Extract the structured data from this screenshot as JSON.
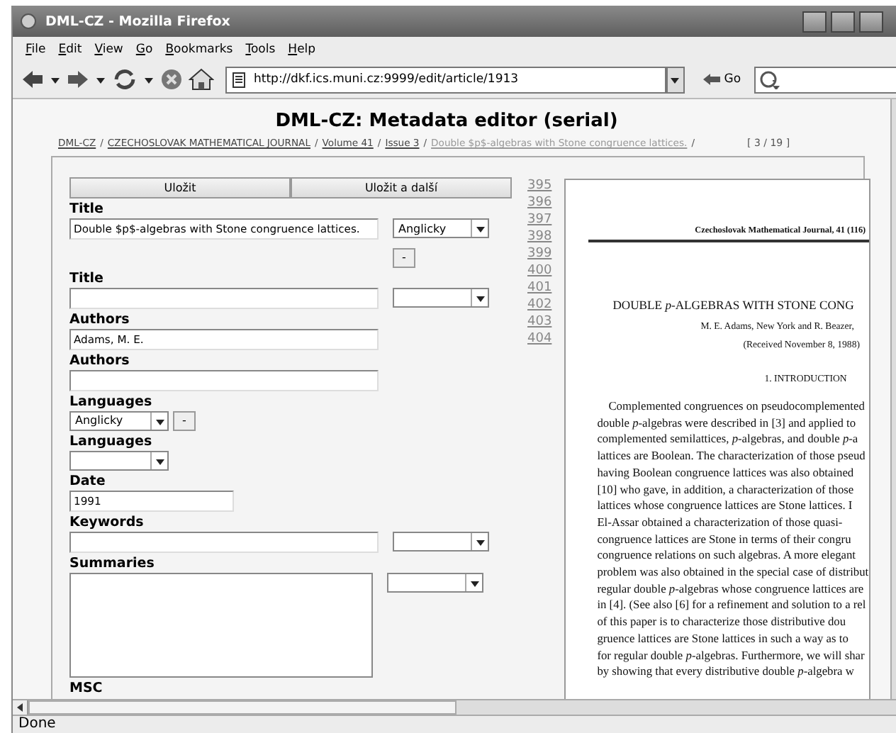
{
  "window": {
    "title": "DML-CZ - Mozilla Firefox"
  },
  "menu": [
    "File",
    "Edit",
    "View",
    "Go",
    "Bookmarks",
    "Tools",
    "Help"
  ],
  "toolbar": {
    "url": "http://dkf.ics.muni.cz:9999/edit/article/1913",
    "go": "Go"
  },
  "page": {
    "heading": "DML-CZ: Metadata editor (serial)",
    "breadcrumb": [
      {
        "label": "DML-CZ",
        "kind": "link",
        "after": "/"
      },
      {
        "label": "CZECHOSLOVAK MATHEMATICAL JOURNAL",
        "kind": "link",
        "after": "/"
      },
      {
        "label": "Volume 41",
        "kind": "link",
        "after": "/"
      },
      {
        "label": "Issue 3",
        "kind": "link",
        "after": "/"
      },
      {
        "label": "Double $p$-algebras with Stone congruence lattices.",
        "kind": "current",
        "after": "/"
      }
    ],
    "counter": "[ 3 / 19 ]",
    "buttons": [
      "Uložit",
      "Uložit a další"
    ],
    "fields": [
      {
        "label": "Title",
        "kind": "titled",
        "value": "Double $p$-algebras with Stone congruence lattices.",
        "language": "Anglicky",
        "remove": "-"
      },
      {
        "label": "Title",
        "kind": "titled"
      },
      {
        "label": "Authors",
        "kind": "plain",
        "value": "Adams, M. E."
      },
      {
        "label": "Authors",
        "kind": "plain"
      },
      {
        "label": "Languages",
        "kind": "select",
        "value": "Anglicky",
        "remove": "-"
      },
      {
        "label": "Languages",
        "kind": "select"
      },
      {
        "label": "Date",
        "kind": "short",
        "value": "1991"
      },
      {
        "label": "Keywords",
        "kind": "titled"
      },
      {
        "label": "Summaries",
        "kind": "area"
      },
      {
        "label": "MSC",
        "kind": "none"
      }
    ],
    "line_numbers": [
      "395",
      "396",
      "397",
      "398",
      "399",
      "400",
      "401",
      "402",
      "403",
      "404"
    ],
    "document": {
      "journal": "Czechoslovak Mathematical Journal, 41 (116)",
      "title": "DOUBLE *p*-ALGEBRAS WITH STONE CONG",
      "authors": "M. E. Adams, New York and R. Beazer,",
      "received": "(Received November 8, 1988)",
      "section": "1. INTRODUCTION",
      "lines": [
        "Complemented congruences on pseudocomplemented",
        "double *p*-algebras were described in [3] and applied to",
        "complemented semilattices, *p*-algebras, and double *p*-a",
        "lattices are Boolean. The characterization of those pseud",
        "having Boolean congruence lattices was also obtained",
        "[10] who gave, in addition, a characterization of those",
        "lattices whose congruence lattices are Stone lattices. I",
        "El-Assar obtained a characterization of those quasi-",
        "congruence lattices are Stone in terms of their congru",
        "congruence relations on such algebras. A more elegant",
        "problem was also obtained in the special case of distribut",
        "regular double *p*-algebras whose congruence lattices are",
        "in [4]. (See also [6] for a refinement and solution to a rel",
        "of this paper is to characterize those distributive dou",
        "gruence lattices are Stone lattices in such a way as to",
        "for regular double *p*-algebras. Furthermore, we will shar",
        "by showing that every distributive double *p*-algebra w"
      ]
    }
  },
  "status": "Done"
}
